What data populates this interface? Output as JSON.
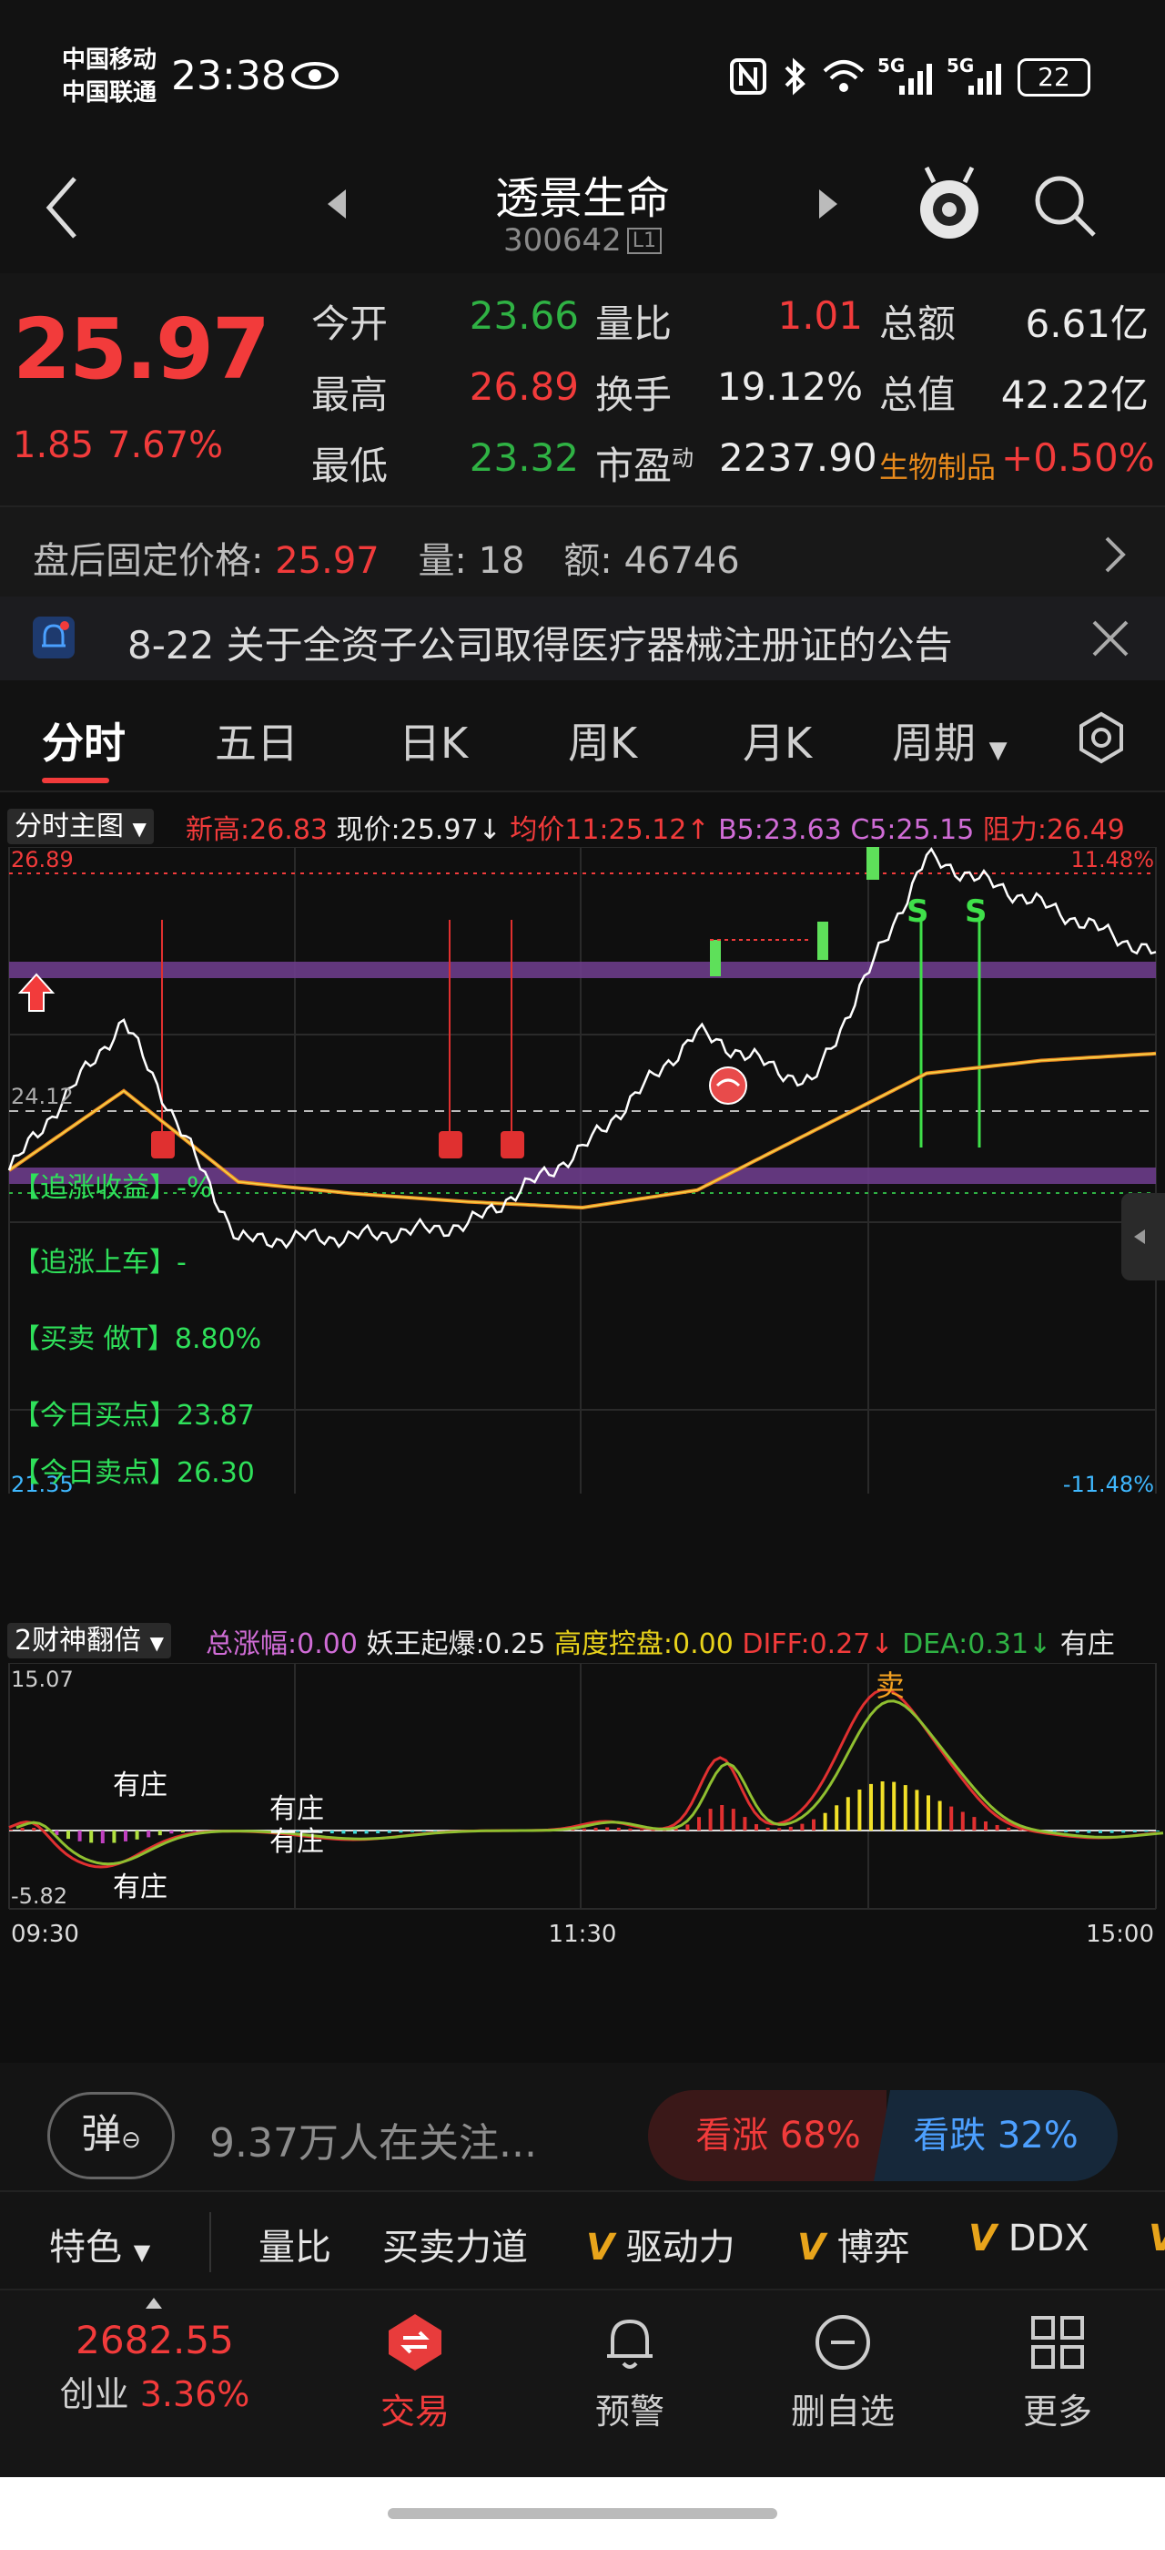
{
  "status": {
    "carrier1": "中国移动",
    "carrier2": "中国联通",
    "time": "23:38",
    "signal1": "5G",
    "signal2": "5G",
    "battery": "22"
  },
  "header": {
    "title": "透景生命",
    "code": "300642",
    "badge": "L1"
  },
  "quote": {
    "price": "25.97",
    "change": "1.85",
    "change_pct": "7.67%",
    "rows": [
      [
        {
          "label": "今开",
          "value": "23.66",
          "tone": "green"
        },
        {
          "label": "量比",
          "value": "1.01",
          "tone": "red"
        },
        {
          "label": "总额",
          "value": "6.61亿",
          "tone": "white"
        }
      ],
      [
        {
          "label": "最高",
          "value": "26.89",
          "tone": "red"
        },
        {
          "label": "换手",
          "value": "19.12%",
          "tone": "white"
        },
        {
          "label": "总值",
          "value": "42.22亿",
          "tone": "white"
        }
      ],
      [
        {
          "label": "最低",
          "value": "23.32",
          "tone": "green"
        },
        {
          "label": "市盈",
          "label_sup": "动",
          "value": "2237.90",
          "tone": "white"
        },
        {
          "label": "生物制品",
          "value": "+0.50%",
          "tone": "red"
        }
      ]
    ]
  },
  "after_hours": {
    "label": "盘后固定价格:",
    "price": "25.97",
    "vol_label": "量:",
    "vol": "18",
    "amt_label": "额:",
    "amt": "46746"
  },
  "notice": {
    "text": "8-22 关于全资子公司取得医疗器械注册证的公告"
  },
  "tabs": [
    "分时",
    "五日",
    "日K",
    "周K",
    "月K",
    "周期"
  ],
  "main_chart": {
    "selector": "分时主图",
    "legend": [
      {
        "text": "新高:26.83",
        "tone": "red"
      },
      {
        "text": "现价:25.97↓",
        "tone": "white"
      },
      {
        "text": "均价11:25.12↑",
        "tone": "red"
      },
      {
        "text": "B5:23.63",
        "tone": "purple"
      },
      {
        "text": "C5:25.15",
        "tone": "purple"
      },
      {
        "text": "阻力:26.49",
        "tone": "red"
      }
    ],
    "y_top": "26.89",
    "y_mid": "24.12",
    "y_bottom": "21.35",
    "pct_top": "11.48%",
    "pct_bottom": "-11.48%",
    "texts": [
      "【追涨收益】-%",
      "【追涨上车】-",
      "【买卖 做T】8.80%",
      "【今日买点】23.87",
      "【今日卖点】26.30"
    ]
  },
  "sub_chart": {
    "selector": "2财神翻倍",
    "legend": [
      {
        "text": "总涨幅:0.00",
        "tone": "purple"
      },
      {
        "text": "妖王起爆:0.25",
        "tone": "white"
      },
      {
        "text": "高度控盘:0.00",
        "tone": "yellow"
      },
      {
        "text": "DIFF:0.27↓",
        "tone": "red"
      },
      {
        "text": "DEA:0.31↓",
        "tone": "green"
      },
      {
        "text": "有庄",
        "tone": "white"
      }
    ],
    "y_top": "15.07",
    "y_bottom": "-5.82",
    "labels": [
      "有庄",
      "有庄",
      "有庄",
      "有庄",
      "卖"
    ],
    "time_start": "09:30",
    "time_mid": "11:30",
    "time_end": "15:00"
  },
  "sentiment": {
    "danmu": "弹",
    "watchers": "9.37万人在关注...",
    "bull": "看涨 68%",
    "bear": "看跌 32%"
  },
  "indicators": {
    "feature": "特色",
    "items": [
      "量比",
      "买卖力道",
      "驱动力",
      "博弈",
      "DDX"
    ],
    "v_mark": "V"
  },
  "bottom_nav": {
    "index_value": "2682.55",
    "index_name": "创业",
    "index_pct": "3.36%",
    "items": [
      "交易",
      "预警",
      "删自选",
      "更多"
    ]
  },
  "chart_data": {
    "type": "line",
    "x": [
      "09:30",
      "11:30",
      "15:00"
    ],
    "ylim": [
      21.35,
      26.89
    ],
    "reference_price": "24.12",
    "series": [
      {
        "name": "现价",
        "values": [
          24.12,
          25.4,
          23.52,
          23.55,
          23.65,
          24.3,
          25.3,
          24.85,
          26.8,
          26.4,
          25.97
        ]
      },
      {
        "name": "均价",
        "values": [
          24.12,
          24.8,
          24.02,
          23.92,
          23.85,
          23.8,
          23.95,
          24.45,
          24.95,
          25.06,
          25.12
        ]
      }
    ]
  }
}
